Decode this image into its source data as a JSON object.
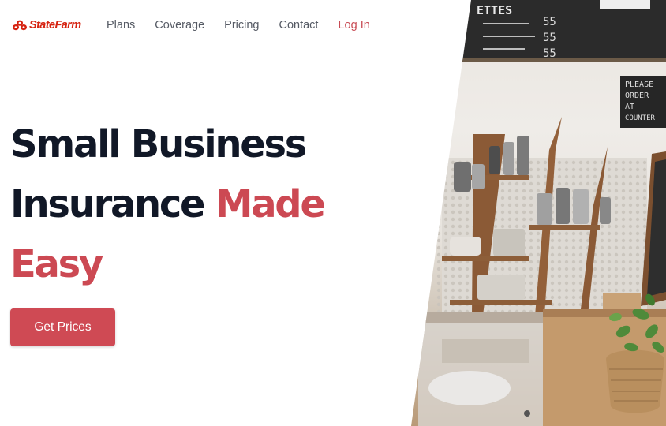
{
  "brand": {
    "name": "StateFarm",
    "color": "#d62311"
  },
  "nav": {
    "items": [
      {
        "label": "Plans"
      },
      {
        "label": "Coverage"
      },
      {
        "label": "Pricing"
      },
      {
        "label": "Contact"
      }
    ],
    "login_label": "Log In"
  },
  "hero": {
    "headline_part1": "Small Business",
    "headline_part2": "Insurance",
    "headline_accent_1": "Made",
    "headline_accent_2": "Easy",
    "accent_color": "#cc4953",
    "cta_label": "Get Prices",
    "cta_color": "#cf4a54"
  },
  "photo": {
    "menu_board_lines": [
      "ETTES",
      "55",
      "55",
      "55"
    ],
    "sign_text": [
      "PLEASE",
      "ORDER",
      "AT",
      "COUNTER"
    ]
  }
}
